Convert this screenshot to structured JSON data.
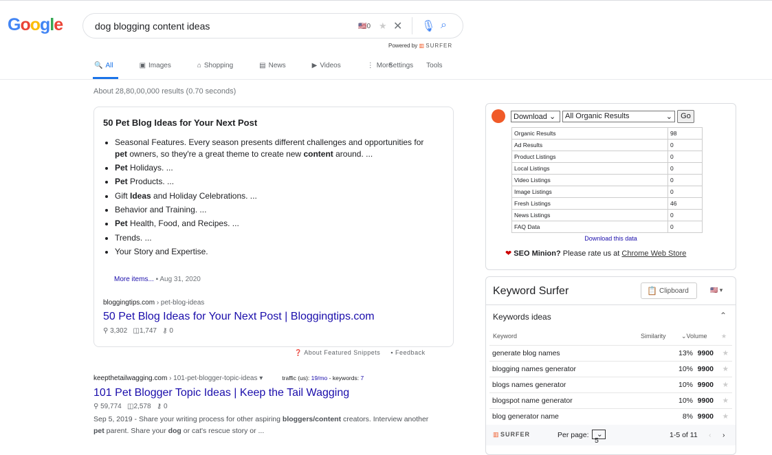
{
  "google": {
    "logo": "Google",
    "query": "dog blogging content ideas",
    "flag_count": "0",
    "powered_by": "Powered by",
    "surfer": "SURFER"
  },
  "tabs": [
    {
      "label": "All",
      "icon": "search-icon"
    },
    {
      "label": "Images",
      "icon": "image-icon"
    },
    {
      "label": "Shopping",
      "icon": "tag-icon"
    },
    {
      "label": "News",
      "icon": "news-icon"
    },
    {
      "label": "Videos",
      "icon": "play-icon"
    },
    {
      "label": "More",
      "icon": "more-vert-icon"
    }
  ],
  "tools": {
    "settings": "Settings",
    "tools": "Tools"
  },
  "stats": "About 28,80,00,000 results (0.70 seconds)",
  "snippet": {
    "heading": "50 Pet Blog Ideas for Your Next Post",
    "items": [
      [
        [
          "Seasonal Features. Every season presents different challenges and opportunities for ",
          0
        ],
        [
          "pet",
          1
        ],
        [
          " owners, so they're a great theme to create new ",
          0
        ],
        [
          "content",
          1
        ],
        [
          " around. ...",
          0
        ]
      ],
      [
        [
          "Pet",
          1
        ],
        [
          " Holidays. ...",
          0
        ]
      ],
      [
        [
          "Pet",
          1
        ],
        [
          " Products. ...",
          0
        ]
      ],
      [
        [
          "Gift ",
          0
        ],
        [
          "Ideas",
          1
        ],
        [
          " and Holiday Celebrations. ...",
          0
        ]
      ],
      [
        [
          "Behavior and Training. ...",
          0
        ]
      ],
      [
        [
          "Pet",
          1
        ],
        [
          " Health, Food, and Recipes. ...",
          0
        ]
      ],
      [
        [
          "Trends. ...",
          0
        ]
      ],
      [
        [
          "Your Story and Expertise.",
          0
        ]
      ]
    ],
    "more_items": "More items...",
    "date": "Aug 31, 2020",
    "domain": "bloggingtips.com",
    "path": " › pet-blog-ideas",
    "title": "50 Pet Blog Ideas for Your Next Post | Bloggingtips.com",
    "metric1": "3,302",
    "metric2": "1,747",
    "metric3": "0"
  },
  "about": {
    "about_label": "About Featured Snippets",
    "feedback_label": "Feedback"
  },
  "result2": {
    "domain": "keepthetailwagging.com",
    "path": " › 101-pet-blogger-topic-ideas",
    "traffic_label": "traffic (us): ",
    "traffic": "19/mo",
    "keywords_label": " - keywords: ",
    "keywords": "7",
    "title": "101 Pet Blogger Topic Ideas | Keep the Tail Wagging",
    "metric1": "59,774",
    "metric2": "2,578",
    "metric3": "0",
    "desc": [
      [
        "Sep 5, 2019 - Share your writing process for other aspiring ",
        0
      ],
      [
        "bloggers/content",
        1
      ],
      [
        " creators. Interview another ",
        0
      ],
      [
        "pet",
        1
      ],
      [
        " parent. Share your ",
        0
      ],
      [
        "dog",
        1
      ],
      [
        " or cat's rescue story or ...",
        0
      ]
    ]
  },
  "seo": {
    "download_select": "Download",
    "filter_select": "All Organic Results",
    "go": "Go",
    "rows": [
      [
        "Organic Results",
        "98"
      ],
      [
        "Ad Results",
        "0"
      ],
      [
        "Product Listings",
        "0"
      ],
      [
        "Local Listings",
        "0"
      ],
      [
        "Video Listings",
        "0"
      ],
      [
        "Image Listings",
        "0"
      ],
      [
        "Fresh Listings",
        "46"
      ],
      [
        "News Listings",
        "0"
      ],
      [
        "FAQ Data",
        "0"
      ]
    ],
    "download_link": "Download this data",
    "rate_bold": "SEO Minion?",
    "rate_text": " Please rate us at ",
    "rate_link": "Chrome Web Store"
  },
  "ks": {
    "title": "Keyword Surfer",
    "clipboard": "Clipboard",
    "section": "Keywords ideas",
    "col_keyword": "Keyword",
    "col_similarity": "Similarity",
    "col_volume": "Volume",
    "rows": [
      [
        "generate blog names",
        "13%",
        "9900"
      ],
      [
        "blogging names generator",
        "10%",
        "9900"
      ],
      [
        "blogs names generator",
        "10%",
        "9900"
      ],
      [
        "blogspot name generator",
        "10%",
        "9900"
      ],
      [
        "blog generator name",
        "8%",
        "9900"
      ]
    ],
    "brand": "SURFER",
    "per_page_label": "Per page:",
    "per_page": "5",
    "range": "1-5 of 11"
  }
}
